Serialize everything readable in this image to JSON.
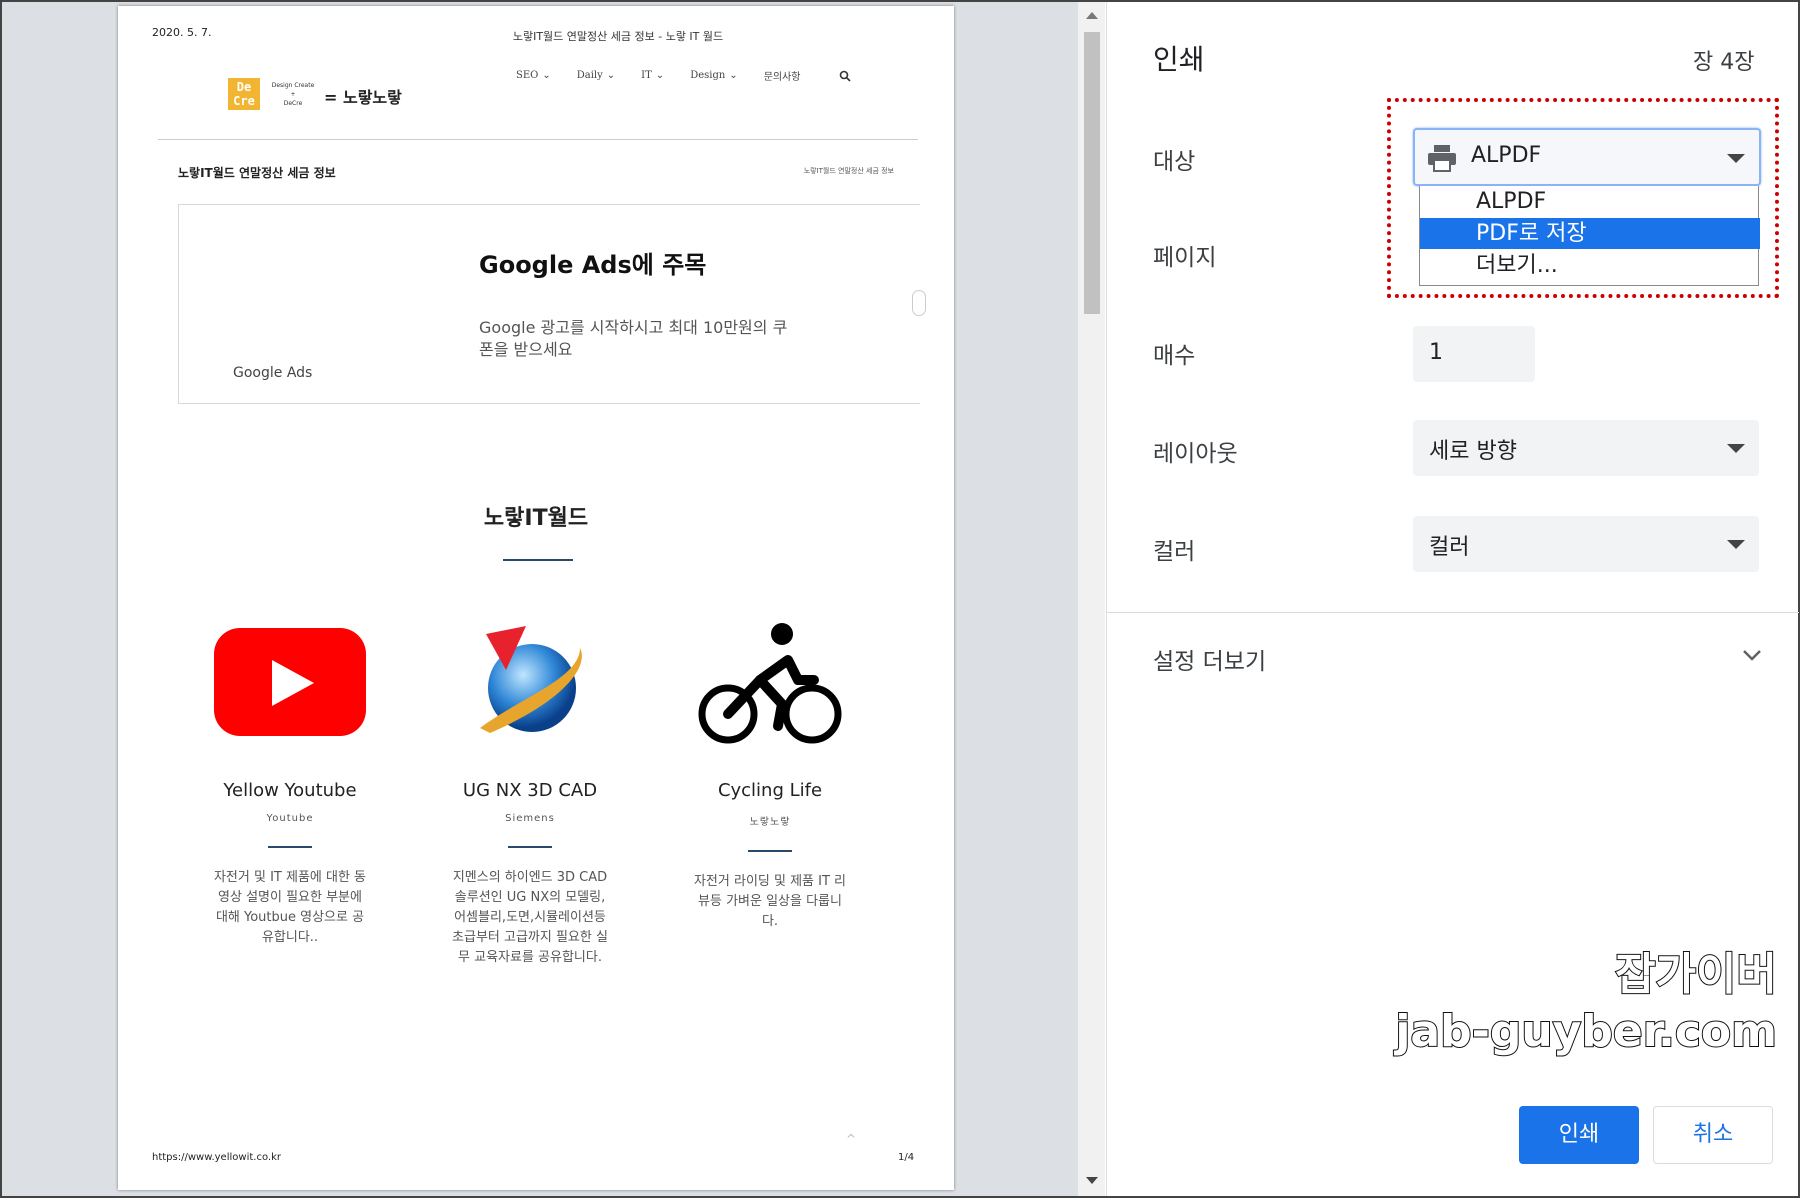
{
  "preview": {
    "date": "2020. 5. 7.",
    "header_title": "노랗IT월드 연말정산 세금 정보 - 노랗 IT 월드",
    "logo_text": "= 노랗노랗",
    "logo_box": "De Cre",
    "logo_small_1": "Design Create",
    "logo_small_2": "DeCre",
    "nav": [
      "SEO",
      "Daily",
      "IT",
      "Design",
      "문의사항"
    ],
    "post_title": "노랗IT월드 연말정산 세금 정보",
    "breadcrumb": "노랗IT월드 연말정산 세금 정보",
    "ad": {
      "headline": "Google Ads에 주목",
      "description": "Google 광고를 시작하시고 최대 10만원의 쿠폰을 받으세요",
      "brand": "Google Ads"
    },
    "section_title": "노랗IT월드",
    "cards": [
      {
        "title": "Yellow Youtube",
        "subtitle": "Youtube",
        "text": "자전거 및 IT 제품에 대한 동영상 설명이 필요한 부분에 대해 Youtbue 영상으로 공유합니다.."
      },
      {
        "title": "UG NX 3D CAD",
        "subtitle": "Siemens",
        "text": "지멘스의 하이엔드 3D CAD 솔루션인 UG NX의 모델링,어셈블리,도면,시뮬레이션등 초급부터 고급까지 필요한 실무 교육자료를 공유합니다."
      },
      {
        "title": "Cycling Life",
        "subtitle": "노랗노랗",
        "text": "자전거 라이딩 및 제품 IT 리뷰등 가벼운 일상을 다룹니다."
      }
    ],
    "url": "https://www.yellowit.co.kr",
    "page_num": "1/4"
  },
  "panel": {
    "title": "인쇄",
    "sheet_count": "장 4장",
    "labels": {
      "destination": "대상",
      "pages": "페이지",
      "copies": "매수",
      "layout": "레이아웃",
      "color": "컬러"
    },
    "destination_value": "ALPDF",
    "dropdown_options": [
      "ALPDF",
      "PDF로 저장",
      "더보기..."
    ],
    "selected_option_index": 1,
    "copies_value": "1",
    "layout_value": "세로 방향",
    "color_value": "컬러",
    "more_settings": "설정 더보기",
    "print_button": "인쇄",
    "cancel_button": "취소"
  },
  "watermark": {
    "line1": "잡가이버",
    "line2": "jab-guyber.com"
  },
  "colors": {
    "accent": "#1a73e8",
    "highlight_box": "#cc0000",
    "youtube_red": "#ff0000"
  }
}
